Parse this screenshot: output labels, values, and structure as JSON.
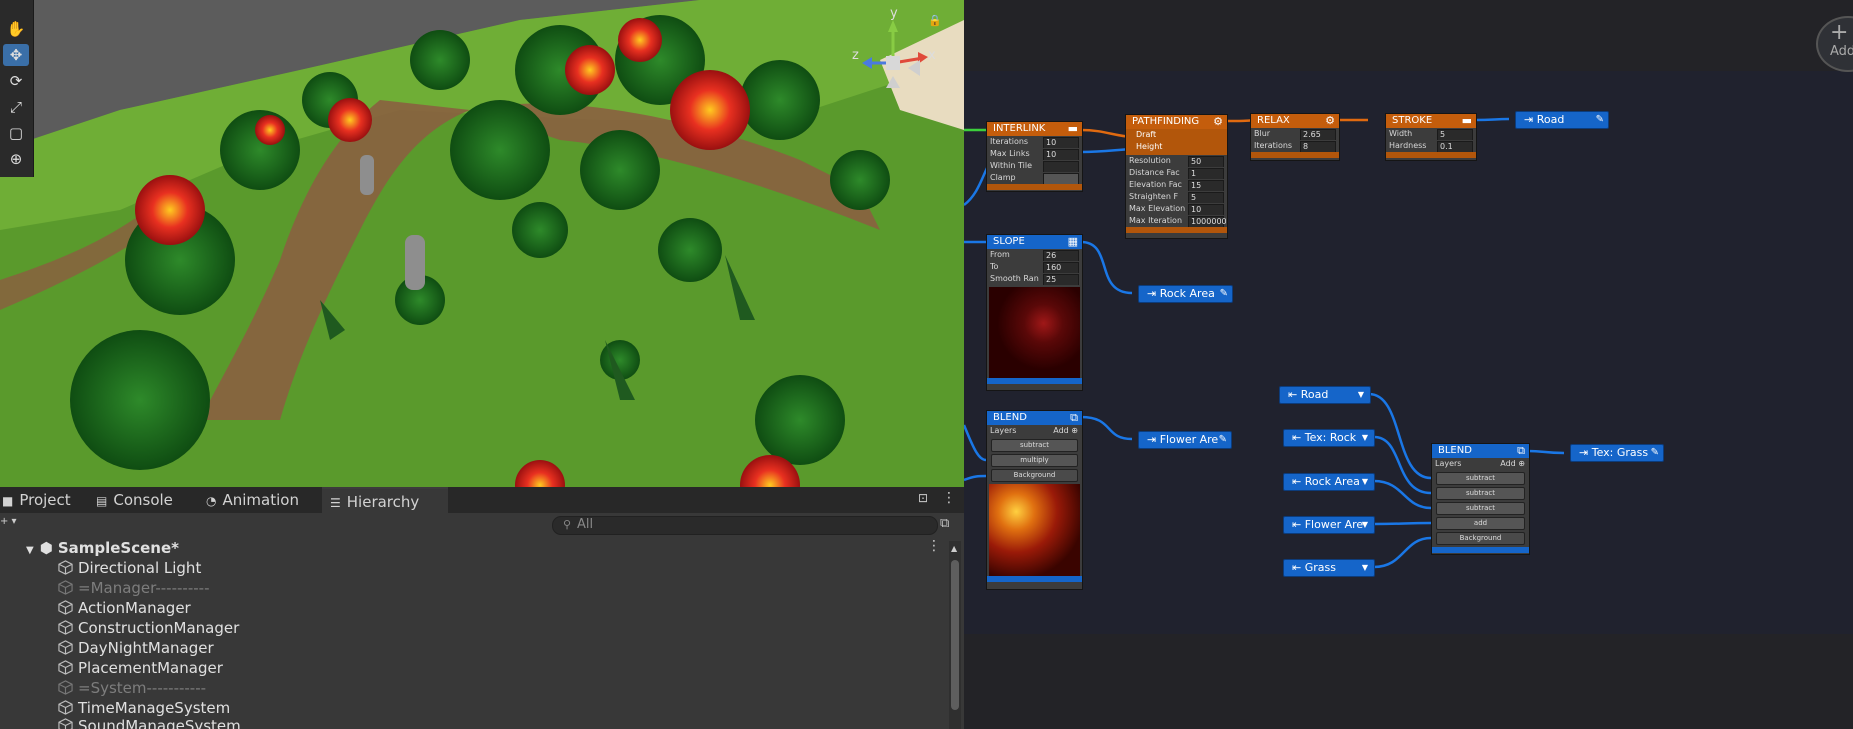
{
  "scene_view": {
    "tools": [
      "hand-tool",
      "move-tool",
      "rotate-tool",
      "scale-tool",
      "rect-tool",
      "transform-tool"
    ],
    "gizmo": {
      "y": "y",
      "x": "x",
      "z": "z"
    }
  },
  "bottom_panel": {
    "tabs": [
      {
        "label": "Project",
        "icon": "folder-icon"
      },
      {
        "label": "Console",
        "icon": "console-icon"
      },
      {
        "label": "Animation",
        "icon": "animation-icon"
      },
      {
        "label": "Hierarchy",
        "icon": "hierarchy-icon"
      }
    ],
    "search_placeholder": "All",
    "scene_name": "SampleScene*",
    "items": [
      {
        "label": "Directional Light",
        "dim": false
      },
      {
        "label": "=Manager----------",
        "dim": true
      },
      {
        "label": "ActionManager",
        "dim": false
      },
      {
        "label": "ConstructionManager",
        "dim": false
      },
      {
        "label": "DayNightManager",
        "dim": false
      },
      {
        "label": "PlacementManager",
        "dim": false
      },
      {
        "label": "=System-----------",
        "dim": true
      },
      {
        "label": "TimeManageSystem",
        "dim": false
      },
      {
        "label": "SoundManageSystem",
        "dim": false
      }
    ]
  },
  "graph": {
    "add_label": "Add",
    "interlink": {
      "title": "INTERLINK",
      "fields": [
        [
          "Iterations",
          "10"
        ],
        [
          "Max Links",
          "10"
        ],
        [
          "Within Tile",
          ""
        ],
        [
          "Clamp",
          ""
        ]
      ]
    },
    "pathfinding": {
      "title": "PATHFINDING",
      "inputs": [
        "Draft",
        "Height"
      ],
      "fields": [
        [
          "Resolution",
          "50"
        ],
        [
          "Distance Fac",
          "1"
        ],
        [
          "Elevation Fac",
          "15"
        ],
        [
          "Straighten F",
          "5"
        ],
        [
          "Max Elevation",
          "10"
        ],
        [
          "Max Iteration",
          "1000000"
        ]
      ]
    },
    "relax": {
      "title": "RELAX",
      "fields": [
        [
          "Blur",
          "2.65"
        ],
        [
          "Iterations",
          "8"
        ]
      ]
    },
    "stroke": {
      "title": "STROKE",
      "fields": [
        [
          "Width",
          "5"
        ],
        [
          "Hardness",
          "0.1"
        ]
      ]
    },
    "slope": {
      "title": "SLOPE",
      "fields": [
        [
          "From",
          "26"
        ],
        [
          "To",
          "160"
        ],
        [
          "Smooth Ran",
          "25"
        ]
      ]
    },
    "blend1": {
      "title": "BLEND",
      "layers_label": "Layers",
      "add": "Add",
      "layers": [
        "subtract",
        "multiply"
      ],
      "background": "Background"
    },
    "blend2": {
      "title": "BLEND",
      "layers_label": "Layers",
      "add": "Add",
      "layers": [
        "subtract",
        "subtract",
        "subtract",
        "add"
      ],
      "background": "Background"
    },
    "outputs": {
      "road": "Road",
      "rock_area": "Rock Area",
      "flower_area": "Flower Are",
      "tex_grass": "Tex: Grass"
    },
    "inputs": {
      "road": "Road",
      "tex_rock": "Tex: Rock",
      "rock_area": "Rock Area",
      "flower_area": "Flower Are",
      "grass": "Grass"
    }
  },
  "colors": {
    "accent": "#1565c9",
    "node_orange": "#c45d0c",
    "wire_blue": "#1a77e6",
    "wire_orange": "#e06a10",
    "wire_green": "#3cd03c"
  }
}
